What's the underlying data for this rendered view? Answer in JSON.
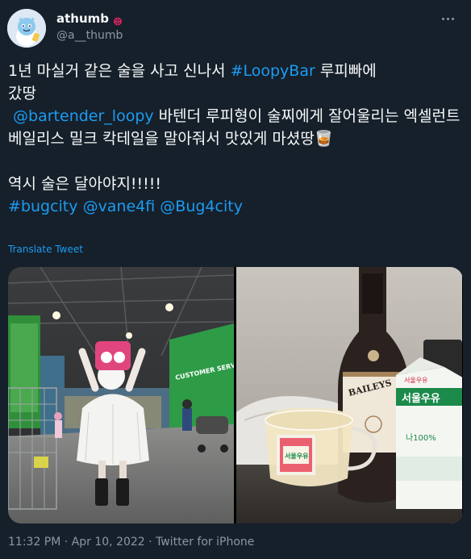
{
  "author": {
    "display_name": "athumb",
    "handle": "@a__thumb",
    "badge_emoji": "🐞"
  },
  "tweet": {
    "line1_part1": "1년 마실거 같은 술을 사고 신나서 ",
    "hashtag_loopybar": "#LoopyBar",
    "line1_part2": " 루피빠에\n갔땅\n ",
    "mention_bartender": "@bartender_loopy",
    "line2": " 바텐더 루피형이 술찌에게 잘어울리는 엑셀런트 베일리스 밀크 칵테일을 말아줘서 맛있게 마셨땅",
    "emoji_glass": "🥃",
    "line3": "\n\n역시 술은 달아야지!!!!!\n",
    "hashtag_bugcity": "#bugcity",
    "space": " ",
    "mention_vane": "@vane4fi",
    "mention_bug": "@Bug4city"
  },
  "translate_label": "Translate Tweet",
  "photo_labels": {
    "store_sign": "CUSTOMER SERVICE",
    "baileys_brand": "BAILEYS",
    "milk_brand": "서울우유",
    "milk_brand_small": "서울우유",
    "milk_100": "나100%",
    "glass_label": "서울우유"
  },
  "meta": {
    "time": "11:32 PM",
    "sep1": " · ",
    "date": "Apr 10, 2022",
    "sep2": " · ",
    "source": "Twitter for iPhone"
  },
  "colors": {
    "background": "#15202b",
    "link": "#1d9bf0",
    "secondary_text": "#8b98a5"
  }
}
